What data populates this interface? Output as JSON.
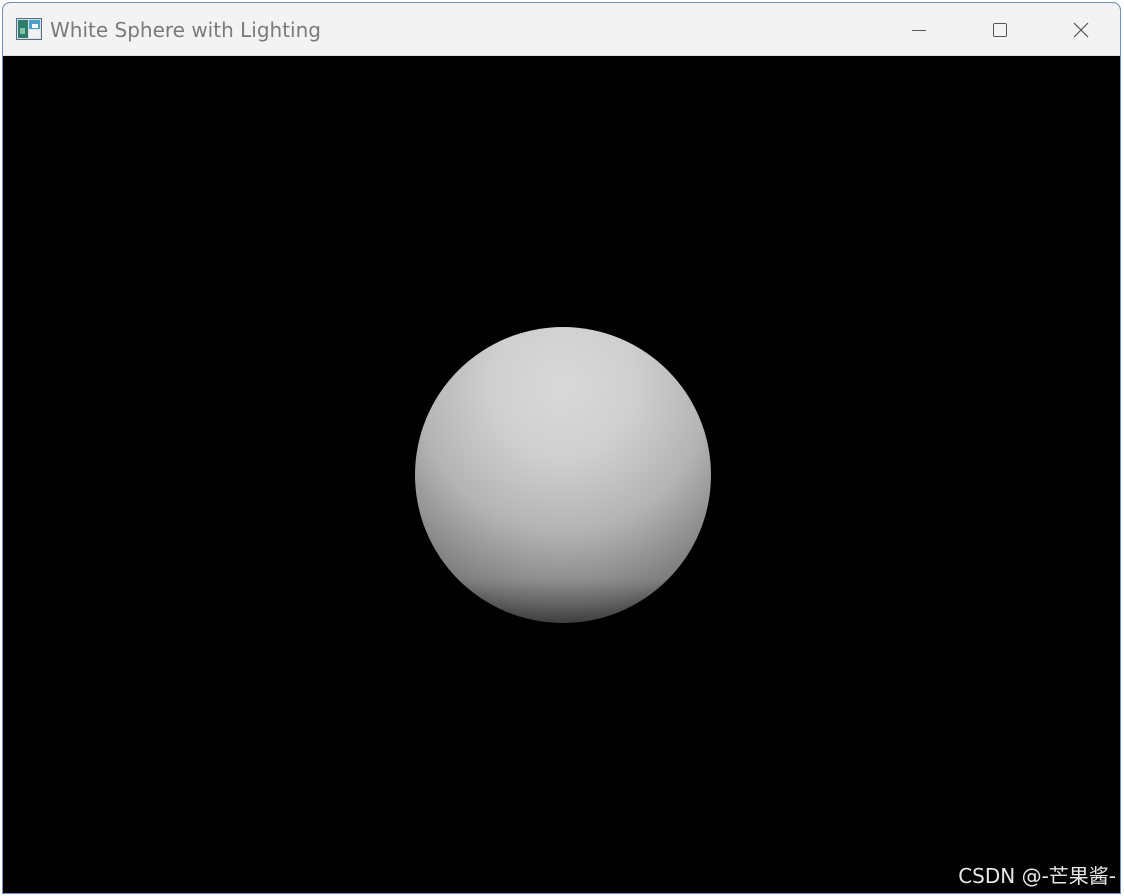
{
  "window": {
    "title": "White Sphere with Lighting",
    "icon": "app-window-icon",
    "controls": {
      "minimize_icon": "minimize-icon",
      "maximize_icon": "maximize-icon",
      "close_icon": "close-icon"
    }
  },
  "scene": {
    "background_color": "#000000",
    "object": "sphere",
    "sphere_color": "#ffffff",
    "lighting": "diffuse, light from upper front"
  },
  "watermark": {
    "text": "CSDN @-芒果酱-"
  }
}
